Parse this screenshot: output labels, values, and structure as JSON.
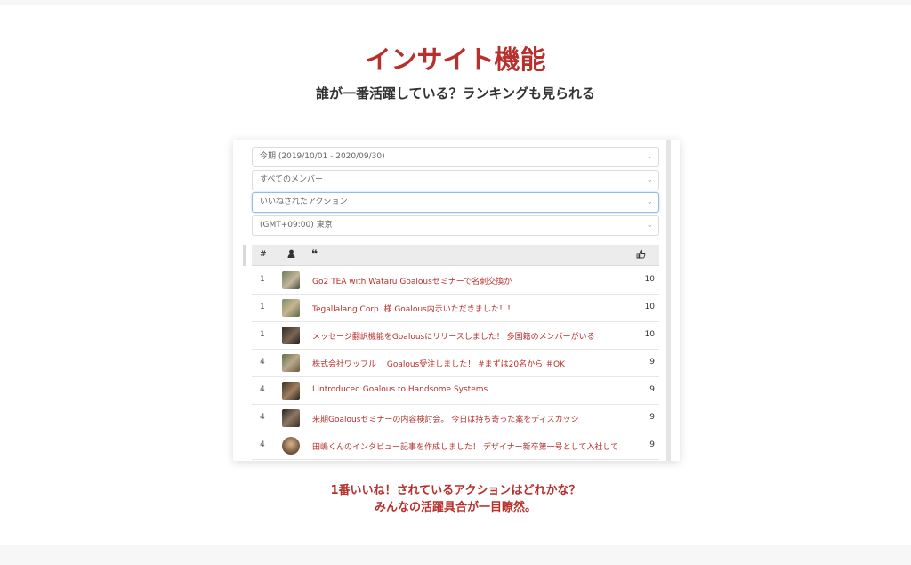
{
  "heading": {
    "title": "インサイト機能",
    "subtitle": "誰が一番活躍している？ランキングも見られる"
  },
  "filters": {
    "period": "今期 (2019/10/01 - 2020/09/30)",
    "members": "すべてのメンバー",
    "type": "いいねされたアクション",
    "timezone": "(GMT+09:00) 東京"
  },
  "table": {
    "headers": {
      "rank": "#",
      "user_icon": "user-icon",
      "quote_icon": "quote-icon",
      "like_icon": "thumbs-up-icon"
    },
    "rows": [
      {
        "rank": "1",
        "text": "Go2 TEA with Wataru Goalousセミナーで名刺交換か",
        "count": "10"
      },
      {
        "rank": "1",
        "text": "Tegallalang Corp. 様 Goalous内示いただきました！！",
        "count": "10"
      },
      {
        "rank": "1",
        "text": "メッセージ翻訳機能をGoalousにリリースしました！ 多国籍のメンバーがいる",
        "count": "10"
      },
      {
        "rank": "4",
        "text": "株式会社ワッフル　 Goalous受注しました！ #まずは20名から ＃OK",
        "count": "9"
      },
      {
        "rank": "4",
        "text": "I introduced Goalous to Handsome Systems",
        "count": "9"
      },
      {
        "rank": "4",
        "text": "来期Goalousセミナーの内容検討会。 今日は持ち寄った案をディスカッシ",
        "count": "9"
      },
      {
        "rank": "4",
        "text": "田嶋くんのインタビュー記事を作成しました！ デザイナー新卒第一号として入社して",
        "count": "9"
      }
    ]
  },
  "caption": {
    "line1": "1番いいね！されているアクションはどれかな？",
    "line2": "みんなの活躍具合が一目瞭然。"
  },
  "colors": {
    "accent": "#b7302c"
  }
}
